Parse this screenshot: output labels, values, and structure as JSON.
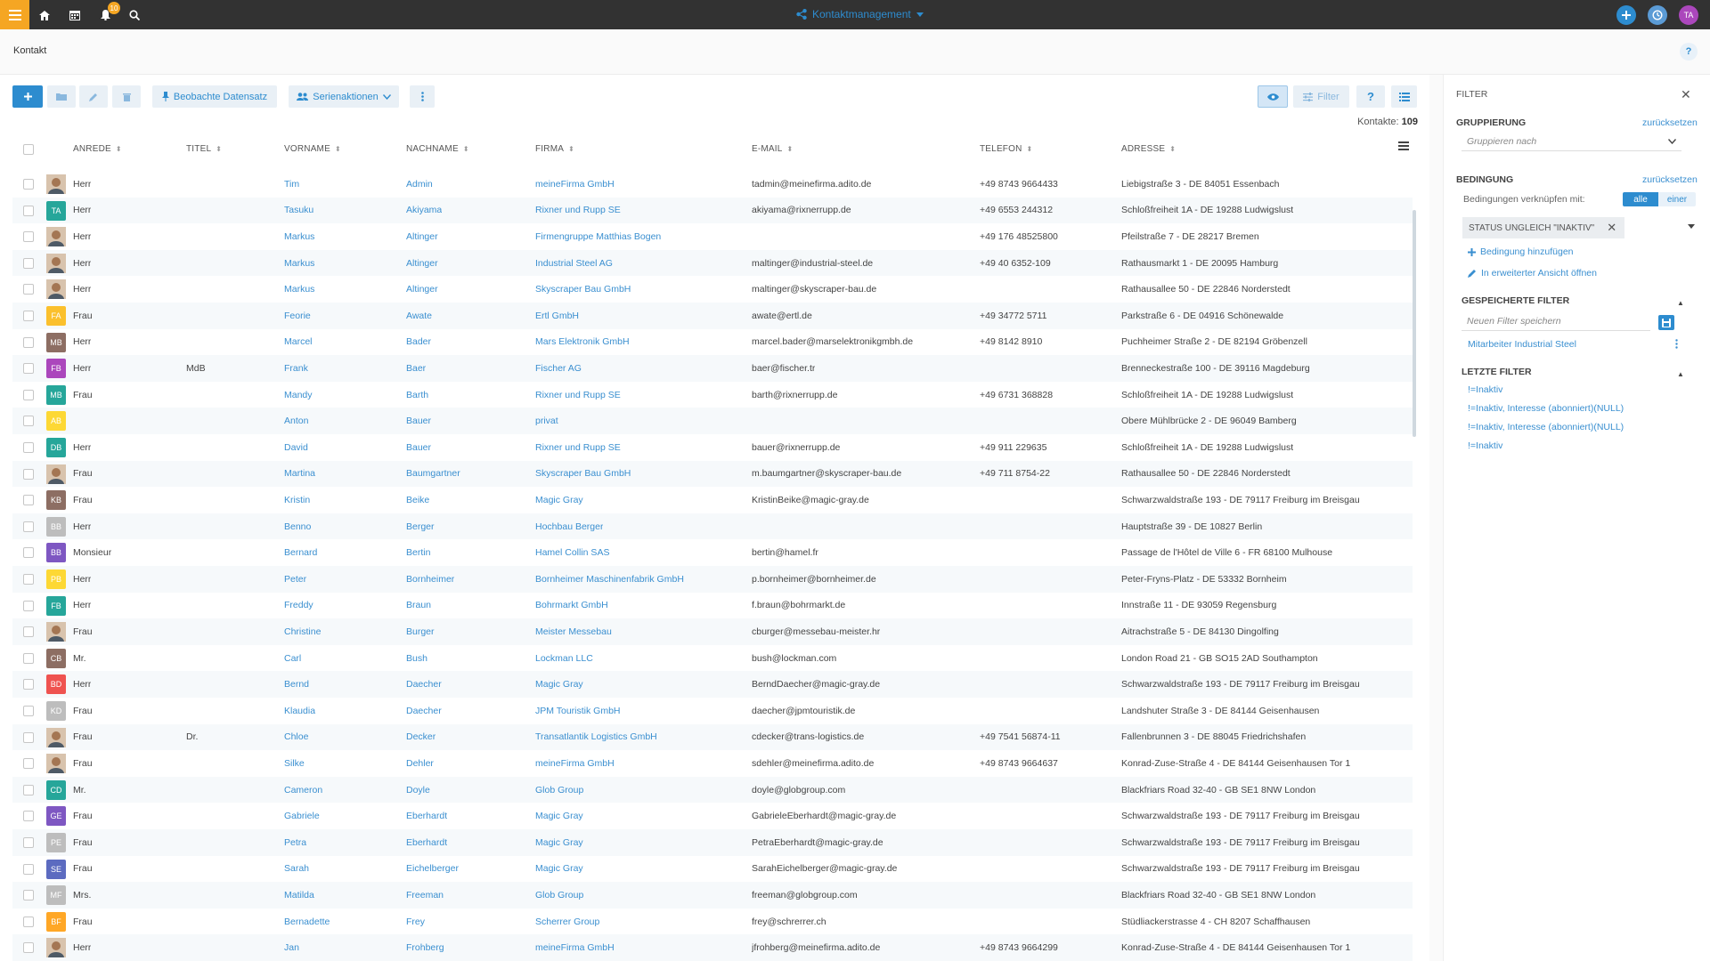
{
  "topbar": {
    "notification_count": "10",
    "module_title": "Kontaktmanagement",
    "user_initials": "TA"
  },
  "page": {
    "title": "Kontakt",
    "help": "?"
  },
  "toolbar": {
    "watch_label": "Beobachte Datensatz",
    "bulk_label": "Serienaktionen",
    "filter_label": "Filter",
    "help_label": "?",
    "count_label": "Kontakte:",
    "count_value": "109"
  },
  "columns": [
    "ANREDE",
    "TITEL",
    "VORNAME",
    "NACHNAME",
    "FIRMA",
    "E-MAIL",
    "TELEFON",
    "ADRESSE"
  ],
  "rows": [
    {
      "av": "photo",
      "anrede": "Herr",
      "titel": "",
      "vorname": "Tim",
      "nachname": "Admin",
      "firma": "meineFirma GmbH",
      "email": "tadmin@meinefirma.adito.de",
      "telefon": "+49 8743 9664433",
      "adresse": "Liebigstraße 3 - DE 84051 Essenbach"
    },
    {
      "av": "TA",
      "color": "#26a69a",
      "anrede": "Herr",
      "titel": "",
      "vorname": "Tasuku",
      "nachname": "Akiyama",
      "firma": "Rixner und Rupp SE",
      "email": "akiyama@rixnerrupp.de",
      "telefon": "+49 6553 244312",
      "adresse": "Schloßfreiheit 1A - DE 19288 Ludwigslust"
    },
    {
      "av": "photo",
      "anrede": "Herr",
      "titel": "",
      "vorname": "Markus",
      "nachname": "Altinger",
      "firma": "Firmengruppe Matthias Bogen",
      "email": "",
      "telefon": "+49 176 48525800",
      "adresse": "Pfeilstraße 7 - DE 28217 Bremen"
    },
    {
      "av": "photo",
      "anrede": "Herr",
      "titel": "",
      "vorname": "Markus",
      "nachname": "Altinger",
      "firma": "Industrial Steel AG",
      "email": "maltinger@industrial-steel.de",
      "telefon": "+49 40 6352-109",
      "adresse": "Rathausmarkt 1 - DE 20095 Hamburg"
    },
    {
      "av": "photo",
      "anrede": "Herr",
      "titel": "",
      "vorname": "Markus",
      "nachname": "Altinger",
      "firma": "Skyscraper Bau GmbH",
      "email": "maltinger@skyscraper-bau.de",
      "telefon": "",
      "adresse": "Rathausallee 50 - DE 22846 Norderstedt"
    },
    {
      "av": "FA",
      "color": "#fbc02d",
      "anrede": "Frau",
      "titel": "",
      "vorname": "Feorie",
      "nachname": "Awate",
      "firma": "Ertl GmbH",
      "email": "awate@ertl.de",
      "telefon": "+49 34772 5711",
      "adresse": "Parkstraße 6 - DE 04916 Schönewalde"
    },
    {
      "av": "MB",
      "color": "#8d6e63",
      "anrede": "Herr",
      "titel": "",
      "vorname": "Marcel",
      "nachname": "Bader",
      "firma": "Mars Elektronik GmbH",
      "email": "marcel.bader@marselektronikgmbh.de",
      "telefon": "+49 8142 8910",
      "adresse": "Puchheimer Straße 2 - DE 82194 Gröbenzell"
    },
    {
      "av": "FB",
      "color": "#ab47bc",
      "anrede": "Herr",
      "titel": "MdB",
      "vorname": "Frank",
      "nachname": "Baer",
      "firma": "Fischer AG",
      "email": "baer@fischer.tr",
      "telefon": "",
      "adresse": "Brenneckestraße 100 - DE 39116 Magdeburg"
    },
    {
      "av": "MB",
      "color": "#26a69a",
      "anrede": "Frau",
      "titel": "",
      "vorname": "Mandy",
      "nachname": "Barth",
      "firma": "Rixner und Rupp SE",
      "email": "barth@rixnerrupp.de",
      "telefon": "+49 6731 368828",
      "adresse": "Schloßfreiheit 1A - DE 19288 Ludwigslust"
    },
    {
      "av": "AB",
      "color": "#fdd835",
      "anrede": "",
      "titel": "",
      "vorname": "Anton",
      "nachname": "Bauer",
      "firma": "privat",
      "email": "",
      "telefon": "",
      "adresse": "Obere Mühlbrücke 2 - DE 96049 Bamberg"
    },
    {
      "av": "DB",
      "color": "#26a69a",
      "anrede": "Herr",
      "titel": "",
      "vorname": "David",
      "nachname": "Bauer",
      "firma": "Rixner und Rupp SE",
      "email": "bauer@rixnerrupp.de",
      "telefon": "+49 911 229635",
      "adresse": "Schloßfreiheit 1A - DE 19288 Ludwigslust"
    },
    {
      "av": "photo",
      "anrede": "Frau",
      "titel": "",
      "vorname": "Martina",
      "nachname": "Baumgartner",
      "firma": "Skyscraper Bau GmbH",
      "email": "m.baumgartner@skyscraper-bau.de",
      "telefon": "+49 711 8754-22",
      "adresse": "Rathausallee 50 - DE 22846 Norderstedt"
    },
    {
      "av": "KB",
      "color": "#8d6e63",
      "anrede": "Frau",
      "titel": "",
      "vorname": "Kristin",
      "nachname": "Beike",
      "firma": "Magic Gray",
      "email": "KristinBeike@magic-gray.de",
      "telefon": "",
      "adresse": "Schwarzwaldstraße 193 - DE 79117 Freiburg im Breisgau"
    },
    {
      "av": "BB",
      "color": "#bdbdbd",
      "anrede": "Herr",
      "titel": "",
      "vorname": "Benno",
      "nachname": "Berger",
      "firma": "Hochbau Berger",
      "email": "",
      "telefon": "",
      "adresse": "Hauptstraße 39 - DE 10827 Berlin"
    },
    {
      "av": "BB",
      "color": "#7e57c2",
      "anrede": "Monsieur",
      "titel": "",
      "vorname": "Bernard",
      "nachname": "Bertin",
      "firma": "Hamel Collin SAS",
      "email": "bertin@hamel.fr",
      "telefon": "",
      "adresse": "Passage de l'Hôtel de Ville 6 - FR 68100 Mulhouse"
    },
    {
      "av": "PB",
      "color": "#fdd835",
      "anrede": "Herr",
      "titel": "",
      "vorname": "Peter",
      "nachname": "Bornheimer",
      "firma": "Bornheimer Maschinenfabrik GmbH",
      "email": "p.bornheimer@bornheimer.de",
      "telefon": "",
      "adresse": "Peter-Fryns-Platz - DE 53332 Bornheim"
    },
    {
      "av": "FB",
      "color": "#26a69a",
      "anrede": "Herr",
      "titel": "",
      "vorname": "Freddy",
      "nachname": "Braun",
      "firma": "Bohrmarkt GmbH",
      "email": "f.braun@bohrmarkt.de",
      "telefon": "",
      "adresse": "Innstraße 11 - DE 93059 Regensburg"
    },
    {
      "av": "photo",
      "anrede": "Frau",
      "titel": "",
      "vorname": "Christine",
      "nachname": "Burger",
      "firma": "Meister Messebau",
      "email": "cburger@messebau-meister.hr",
      "telefon": "",
      "adresse": "Aitrachstraße 5 - DE 84130 Dingolfing"
    },
    {
      "av": "CB",
      "color": "#8d6e63",
      "anrede": "Mr.",
      "titel": "",
      "vorname": "Carl",
      "nachname": "Bush",
      "firma": "Lockman LLC",
      "email": "bush@lockman.com",
      "telefon": "",
      "adresse": "London Road 21 - GB SO15 2AD Southampton"
    },
    {
      "av": "BD",
      "color": "#ef5350",
      "anrede": "Herr",
      "titel": "",
      "vorname": "Bernd",
      "nachname": "Daecher",
      "firma": "Magic Gray",
      "email": "BerndDaecher@magic-gray.de",
      "telefon": "",
      "adresse": "Schwarzwaldstraße 193 - DE 79117 Freiburg im Breisgau"
    },
    {
      "av": "KD",
      "color": "#bdbdbd",
      "anrede": "Frau",
      "titel": "",
      "vorname": "Klaudia",
      "nachname": "Daecher",
      "firma": "JPM Touristik GmbH",
      "email": "daecher@jpmtouristik.de",
      "telefon": "",
      "adresse": "Landshuter Straße 3 - DE 84144 Geisenhausen"
    },
    {
      "av": "photo",
      "anrede": "Frau",
      "titel": "Dr.",
      "vorname": "Chloe",
      "nachname": "Decker",
      "firma": "Transatlantik Logistics GmbH",
      "email": "cdecker@trans-logistics.de",
      "telefon": "+49 7541 56874-11",
      "adresse": "Fallenbrunnen 3 - DE 88045 Friedrichshafen"
    },
    {
      "av": "photo",
      "anrede": "Frau",
      "titel": "",
      "vorname": "Silke",
      "nachname": "Dehler",
      "firma": "meineFirma GmbH",
      "email": "sdehler@meinefirma.adito.de",
      "telefon": "+49 8743 9664637",
      "adresse": "Konrad-Zuse-Straße 4 - DE 84144 Geisenhausen Tor 1"
    },
    {
      "av": "CD",
      "color": "#26a69a",
      "anrede": "Mr.",
      "titel": "",
      "vorname": "Cameron",
      "nachname": "Doyle",
      "firma": "Glob Group",
      "email": "doyle@globgroup.com",
      "telefon": "",
      "adresse": "Blackfriars Road 32-40 - GB SE1 8NW London"
    },
    {
      "av": "GE",
      "color": "#7e57c2",
      "anrede": "Frau",
      "titel": "",
      "vorname": "Gabriele",
      "nachname": "Eberhardt",
      "firma": "Magic Gray",
      "email": "GabrieleEberhardt@magic-gray.de",
      "telefon": "",
      "adresse": "Schwarzwaldstraße 193 - DE 79117 Freiburg im Breisgau"
    },
    {
      "av": "PE",
      "color": "#bdbdbd",
      "anrede": "Frau",
      "titel": "",
      "vorname": "Petra",
      "nachname": "Eberhardt",
      "firma": "Magic Gray",
      "email": "PetraEberhardt@magic-gray.de",
      "telefon": "",
      "adresse": "Schwarzwaldstraße 193 - DE 79117 Freiburg im Breisgau"
    },
    {
      "av": "SE",
      "color": "#5c6bc0",
      "anrede": "Frau",
      "titel": "",
      "vorname": "Sarah",
      "nachname": "Eichelberger",
      "firma": "Magic Gray",
      "email": "SarahEichelberger@magic-gray.de",
      "telefon": "",
      "adresse": "Schwarzwaldstraße 193 - DE 79117 Freiburg im Breisgau"
    },
    {
      "av": "MF",
      "color": "#bdbdbd",
      "anrede": "Mrs.",
      "titel": "",
      "vorname": "Matilda",
      "nachname": "Freeman",
      "firma": "Glob Group",
      "email": "freeman@globgroup.com",
      "telefon": "",
      "adresse": "Blackfriars Road 32-40 - GB SE1 8NW London"
    },
    {
      "av": "BF",
      "color": "#ffa726",
      "anrede": "Frau",
      "titel": "",
      "vorname": "Bernadette",
      "nachname": "Frey",
      "firma": "Scherrer Group",
      "email": "frey@schrerrer.ch",
      "telefon": "",
      "adresse": "Stüdliackerstrasse 4 - CH 8207 Schaffhausen"
    },
    {
      "av": "photo",
      "anrede": "Herr",
      "titel": "",
      "vorname": "Jan",
      "nachname": "Frohberg",
      "firma": "meineFirma GmbH",
      "email": "jfrohberg@meinefirma.adito.de",
      "telefon": "+49 8743 9664299",
      "adresse": "Konrad-Zuse-Straße 4 - DE 84144 Geisenhausen Tor 1"
    }
  ],
  "filter_panel": {
    "title": "FILTER",
    "grouping_heading": "GRUPPIERUNG",
    "reset_label": "zurücksetzen",
    "group_placeholder": "Gruppieren nach",
    "condition_heading": "BEDINGUNG",
    "combine_label": "Bedingungen verknüpfen mit:",
    "toggle_all": "alle",
    "toggle_one": "einer",
    "chip_label": "STATUS UNGLEICH \"INAKTIV\"",
    "add_condition": "Bedingung hinzufügen",
    "open_extended": "In erweiterter Ansicht öffnen",
    "saved_heading": "GESPEICHERTE FILTER",
    "new_filter_placeholder": "Neuen Filter speichern",
    "saved_filters": [
      "Mitarbeiter Industrial Steel"
    ],
    "recent_heading": "LETZTE FILTER",
    "recent_filters": [
      "!=Inaktiv",
      "!=Inaktiv, Interesse (abonniert)(NULL)",
      "!=Inaktiv, Interesse (abonniert)(NULL)",
      "!=Inaktiv"
    ]
  }
}
